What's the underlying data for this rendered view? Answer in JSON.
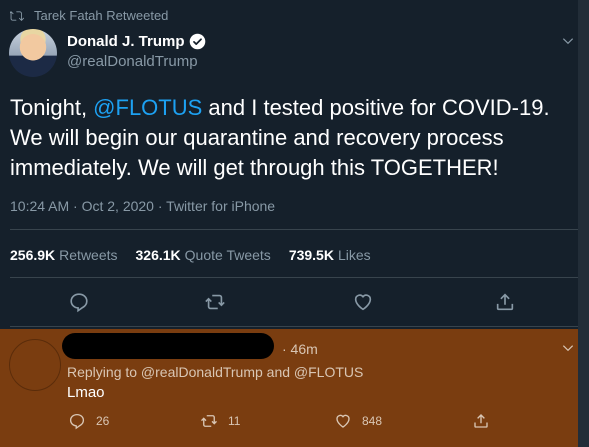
{
  "retweet_header": {
    "text": "Tarek Fatah Retweeted"
  },
  "tweet": {
    "author_name": "Donald J. Trump",
    "handle": "@realDonaldTrump",
    "text_part1": "Tonight, ",
    "mention": "@FLOTUS",
    "text_part2": " and I tested positive for COVID-19. We will begin our quarantine and recovery process immediately. We will get through this TOGETHER!",
    "meta": "10:24 AM · Oct 2, 2020 · Twitter for iPhone",
    "stats": [
      {
        "value": "256.9K",
        "label": "Retweets"
      },
      {
        "value": "326.1K",
        "label": "Quote Tweets"
      },
      {
        "value": "739.5K",
        "label": "Likes"
      }
    ]
  },
  "reply": {
    "time": "· 46m",
    "replying_to": "Replying to @realDonaldTrump and @FLOTUS",
    "text": "Lmao",
    "reply_count": "26",
    "retweet_count": "11",
    "like_count": "848"
  },
  "colors": {
    "background": "#15202b",
    "accent": "#1da1f2",
    "muted": "#8899a6",
    "reply_overlay": "#7a3d10"
  },
  "icons": [
    "retweet-icon",
    "verified-icon",
    "chevron-down-icon",
    "reply-icon",
    "like-icon",
    "share-icon"
  ]
}
